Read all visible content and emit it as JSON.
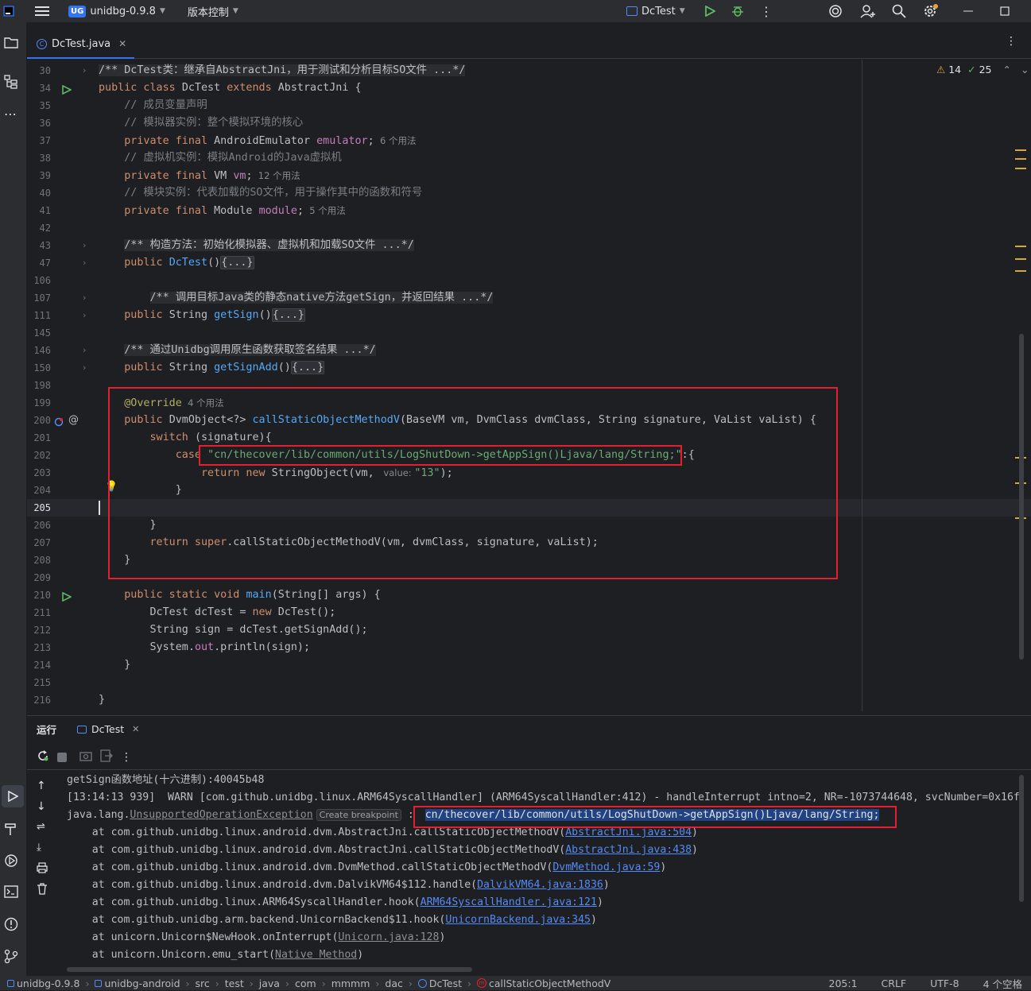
{
  "topbar": {
    "project_badge": "UG",
    "project": "unidbg-0.9.8",
    "vcs": "版本控制",
    "run_config": "DcTest"
  },
  "tab": {
    "file": "DcTest.java"
  },
  "inspections": {
    "warnings": "14",
    "weak": "25"
  },
  "editor": {
    "lines": [
      {
        "n": "30",
        "fold": true,
        "parts": [
          [
            "cmblock",
            "/** DcTest类：继承自AbstractJni，用于测试和分析目标SO文件 ...*/"
          ]
        ]
      },
      {
        "n": "34",
        "run": true,
        "parts": [
          [
            "kw",
            "public class "
          ],
          [
            "",
            "DcTest "
          ],
          [
            "kw",
            "extends "
          ],
          [
            "",
            "AbstractJni {"
          ]
        ]
      },
      {
        "n": "35",
        "parts": [
          [
            "cm",
            "    // 成员变量声明"
          ]
        ]
      },
      {
        "n": "36",
        "parts": [
          [
            "cm",
            "    // 模拟器实例：整个模拟环境的核心"
          ]
        ]
      },
      {
        "n": "37",
        "parts": [
          [
            "kw",
            "    private final "
          ],
          [
            "",
            "AndroidEmulator "
          ],
          [
            "fld",
            "emulator"
          ],
          [
            "",
            ";"
          ],
          [
            "hint",
            "  6 个用法"
          ]
        ]
      },
      {
        "n": "38",
        "parts": [
          [
            "cm",
            "    // 虚拟机实例：模拟Android的Java虚拟机"
          ]
        ]
      },
      {
        "n": "39",
        "parts": [
          [
            "kw",
            "    private final "
          ],
          [
            "",
            "VM "
          ],
          [
            "fld",
            "vm"
          ],
          [
            "",
            ";"
          ],
          [
            "hint",
            "  12 个用法"
          ]
        ]
      },
      {
        "n": "40",
        "parts": [
          [
            "cm",
            "    // 模块实例：代表加载的SO文件，用于操作其中的函数和符号"
          ]
        ]
      },
      {
        "n": "41",
        "parts": [
          [
            "kw",
            "    private final "
          ],
          [
            "",
            "Module "
          ],
          [
            "fld",
            "module"
          ],
          [
            "",
            ";"
          ],
          [
            "hint",
            "  5 个用法"
          ]
        ]
      },
      {
        "n": "42",
        "parts": []
      },
      {
        "n": "43",
        "fold": true,
        "parts": [
          [
            "",
            "    "
          ],
          [
            "cmblock",
            "/** 构造方法：初始化模拟器、虚拟机和加载SO文件 ...*/"
          ]
        ]
      },
      {
        "n": "47",
        "fold": true,
        "parts": [
          [
            "kw",
            "    public "
          ],
          [
            "fn",
            "DcTest"
          ],
          [
            "",
            "()"
          ],
          [
            "fold",
            "{...}"
          ]
        ]
      },
      {
        "n": "106",
        "parts": []
      },
      {
        "n": "107",
        "fold": true,
        "parts": [
          [
            "",
            "        "
          ],
          [
            "cmblock",
            "/** 调用目标Java类的静态native方法getSign，并返回结果 ...*/"
          ]
        ]
      },
      {
        "n": "111",
        "fold": true,
        "parts": [
          [
            "kw",
            "    public "
          ],
          [
            "",
            "String "
          ],
          [
            "fn",
            "getSign"
          ],
          [
            "",
            "()"
          ],
          [
            "fold",
            "{...}"
          ]
        ]
      },
      {
        "n": "145",
        "parts": []
      },
      {
        "n": "146",
        "fold": true,
        "parts": [
          [
            "",
            "    "
          ],
          [
            "cmblock",
            "/** 通过Unidbg调用原生函数获取签名结果 ...*/"
          ]
        ]
      },
      {
        "n": "150",
        "fold": true,
        "parts": [
          [
            "kw",
            "    public "
          ],
          [
            "",
            "String "
          ],
          [
            "fn",
            "getSignAdd"
          ],
          [
            "",
            "()"
          ],
          [
            "fold",
            "{...}"
          ]
        ]
      },
      {
        "n": "198",
        "parts": []
      },
      {
        "n": "199",
        "parts": [
          [
            "ann",
            "    @Override"
          ],
          [
            "hint",
            "  4 个用法"
          ]
        ]
      },
      {
        "n": "200",
        "override": true,
        "parts": [
          [
            "kw",
            "    public "
          ],
          [
            "",
            "DvmObject<?> "
          ],
          [
            "fn",
            "callStaticObjectMethodV"
          ],
          [
            "",
            "(BaseVM vm, DvmClass dvmClass, String signature, VaList vaList) {"
          ]
        ]
      },
      {
        "n": "201",
        "parts": [
          [
            "kw",
            "        switch "
          ],
          [
            "",
            "(signature){"
          ]
        ]
      },
      {
        "n": "202",
        "parts": [
          [
            "kw",
            "            case "
          ],
          [
            "str",
            "\"cn/thecover/lib/common/utils/LogShutDown->getAppSign()Ljava/lang/String;\""
          ],
          [
            "",
            ":{"
          ]
        ]
      },
      {
        "n": "203",
        "parts": [
          [
            "kw",
            "                return new "
          ],
          [
            "",
            "StringObject(vm, "
          ],
          [
            "hint",
            " value: "
          ],
          [
            "str",
            "\"13\""
          ],
          [
            "",
            ");"
          ]
        ]
      },
      {
        "n": "204",
        "bulb": true,
        "parts": [
          [
            "",
            "            }"
          ]
        ]
      },
      {
        "n": "205",
        "current": true,
        "parts": []
      },
      {
        "n": "206",
        "parts": [
          [
            "",
            "        }"
          ]
        ]
      },
      {
        "n": "207",
        "parts": [
          [
            "kw",
            "        return super"
          ],
          [
            "",
            ".callStaticObjectMethodV(vm, dvmClass, signature, vaList);"
          ]
        ]
      },
      {
        "n": "208",
        "parts": [
          [
            "",
            "    }"
          ]
        ]
      },
      {
        "n": "209",
        "parts": []
      },
      {
        "n": "210",
        "run": true,
        "parts": [
          [
            "kw",
            "    public static void "
          ],
          [
            "fn",
            "main"
          ],
          [
            "",
            "(String[] args) {"
          ]
        ]
      },
      {
        "n": "211",
        "parts": [
          [
            "",
            "        DcTest dcTest = "
          ],
          [
            "kw",
            "new "
          ],
          [
            "",
            "DcTest();"
          ]
        ]
      },
      {
        "n": "212",
        "parts": [
          [
            "",
            "        String sign = dcTest.getSignAdd();"
          ]
        ]
      },
      {
        "n": "213",
        "parts": [
          [
            "",
            "        System."
          ],
          [
            "fld",
            "out"
          ],
          [
            "",
            ".println(sign);"
          ]
        ]
      },
      {
        "n": "214",
        "parts": [
          [
            "",
            "    }"
          ]
        ]
      },
      {
        "n": "215",
        "parts": []
      },
      {
        "n": "216",
        "parts": [
          [
            "",
            "}"
          ]
        ]
      }
    ]
  },
  "run": {
    "title": "运行",
    "tab": "DcTest",
    "console": {
      "l1": "getSign函数地址(十六进制):40045b48",
      "l2": "[13:14:13 939]  WARN [com.github.unidbg.linux.ARM64SyscallHandler] (ARM64SyscallHandler:412) - handleInterrupt intno=2, NR=-1073744648, svcNumber=0x16f",
      "l3_prefix": "java.lang.",
      "l3_exc": "UnsupportedOperationException",
      "l3_hint": "Create breakpoint",
      "l3_sep": " : ",
      "l3_msg": "cn/thecover/lib/common/utils/LogShutDown->getAppSign()Ljava/lang/String;",
      "stack": [
        {
          "text": "    at com.github.unidbg.linux.android.dvm.AbstractJni.callStaticObjectMethodV(",
          "link": "AbstractJni.java:504",
          "tail": ")"
        },
        {
          "text": "    at com.github.unidbg.linux.android.dvm.AbstractJni.callStaticObjectMethodV(",
          "link": "AbstractJni.java:438",
          "tail": ")"
        },
        {
          "text": "    at com.github.unidbg.linux.android.dvm.DvmMethod.callStaticObjectMethodV(",
          "link": "DvmMethod.java:59",
          "tail": ")"
        },
        {
          "text": "    at com.github.unidbg.linux.android.dvm.DalvikVM64$112.handle(",
          "link": "DalvikVM64.java:1836",
          "tail": ")"
        },
        {
          "text": "    at com.github.unidbg.linux.ARM64SyscallHandler.hook(",
          "link": "ARM64SyscallHandler.java:121",
          "tail": ")"
        },
        {
          "text": "    at com.github.unidbg.arm.backend.UnicornBackend$11.hook(",
          "link": "UnicornBackend.java:345",
          "tail": ")"
        },
        {
          "text": "    at unicorn.Unicorn$NewHook.onInterrupt(",
          "ulink": "Unicorn.java:128",
          "tail": ")"
        },
        {
          "text": "    at unicorn.Unicorn.emu_start(",
          "ulink": "Native Method",
          "tail": ")"
        }
      ]
    }
  },
  "status": {
    "crumbs": [
      "unidbg-0.9.8",
      "unidbg-android",
      "src",
      "test",
      "java",
      "com",
      "mmmm",
      "dac",
      "DcTest",
      "callStaticObjectMethodV"
    ],
    "pos": "205:1",
    "eol": "CRLF",
    "enc": "UTF-8",
    "indent": "4 个空格"
  },
  "colors": {
    "accent": "#3574f0",
    "highlight_box": "#e5202e",
    "selection": "#214283"
  }
}
